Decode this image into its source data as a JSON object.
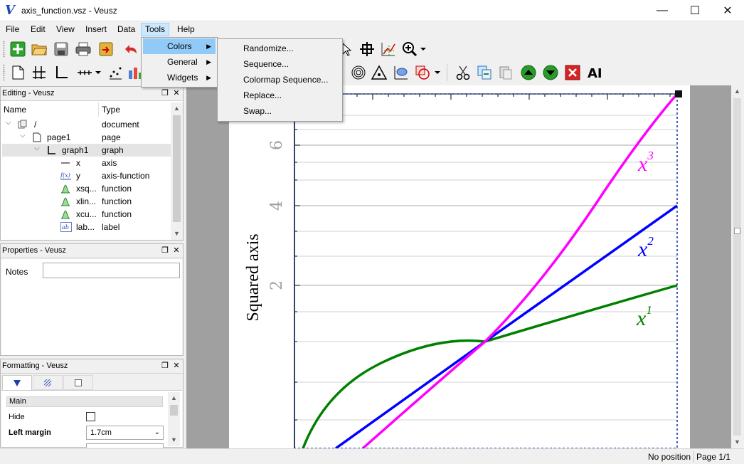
{
  "window": {
    "title": "axis_function.vsz - Veusz",
    "logo": "V"
  },
  "menubar": [
    "File",
    "Edit",
    "View",
    "Insert",
    "Data",
    "Tools",
    "Help"
  ],
  "tools_menu": {
    "items": [
      {
        "label": "Colors",
        "has_submenu": true,
        "highlighted": true
      },
      {
        "label": "General",
        "has_submenu": true
      },
      {
        "label": "Widgets",
        "has_submenu": true
      }
    ]
  },
  "colors_submenu": [
    "Randomize...",
    "Sequence...",
    "Colormap Sequence...",
    "Replace...",
    "Swap..."
  ],
  "editing_dock": {
    "title": "Editing - Veusz",
    "columns": [
      "Name",
      "Type"
    ],
    "rows": [
      {
        "name": "/",
        "type": "document",
        "icon": "document-icon"
      },
      {
        "name": "page1",
        "type": "page",
        "icon": "page-icon"
      },
      {
        "name": "graph1",
        "type": "graph",
        "icon": "graph-icon"
      },
      {
        "name": "x",
        "type": "axis",
        "icon": "axis-icon"
      },
      {
        "name": "y",
        "type": "axis-function",
        "icon": "axis-function-icon"
      },
      {
        "name": "xsq...",
        "type": "function",
        "icon": "function-icon"
      },
      {
        "name": "xlin...",
        "type": "function",
        "icon": "function-icon"
      },
      {
        "name": "xcu...",
        "type": "function",
        "icon": "function-icon"
      },
      {
        "name": "lab...",
        "type": "label",
        "icon": "label-icon"
      }
    ]
  },
  "properties_dock": {
    "title": "Properties - Veusz",
    "notes_label": "Notes",
    "notes_value": ""
  },
  "formatting_dock": {
    "title": "Formatting - Veusz",
    "section": "Main",
    "hide_label": "Hide",
    "left_margin_label": "Left margin",
    "left_margin_value": "1.7cm"
  },
  "plot": {
    "ylabel": "Squared axis",
    "yticks": [
      "6",
      "4",
      "2"
    ],
    "curve_labels": [
      {
        "base": "x",
        "exp": "3",
        "color": "#ff00ff"
      },
      {
        "base": "x",
        "exp": "2",
        "color": "#0000ff"
      },
      {
        "base": "x",
        "exp": "1",
        "color": "#008000"
      }
    ]
  },
  "statusbar": {
    "position": "No position",
    "page": "Page 1/1"
  }
}
